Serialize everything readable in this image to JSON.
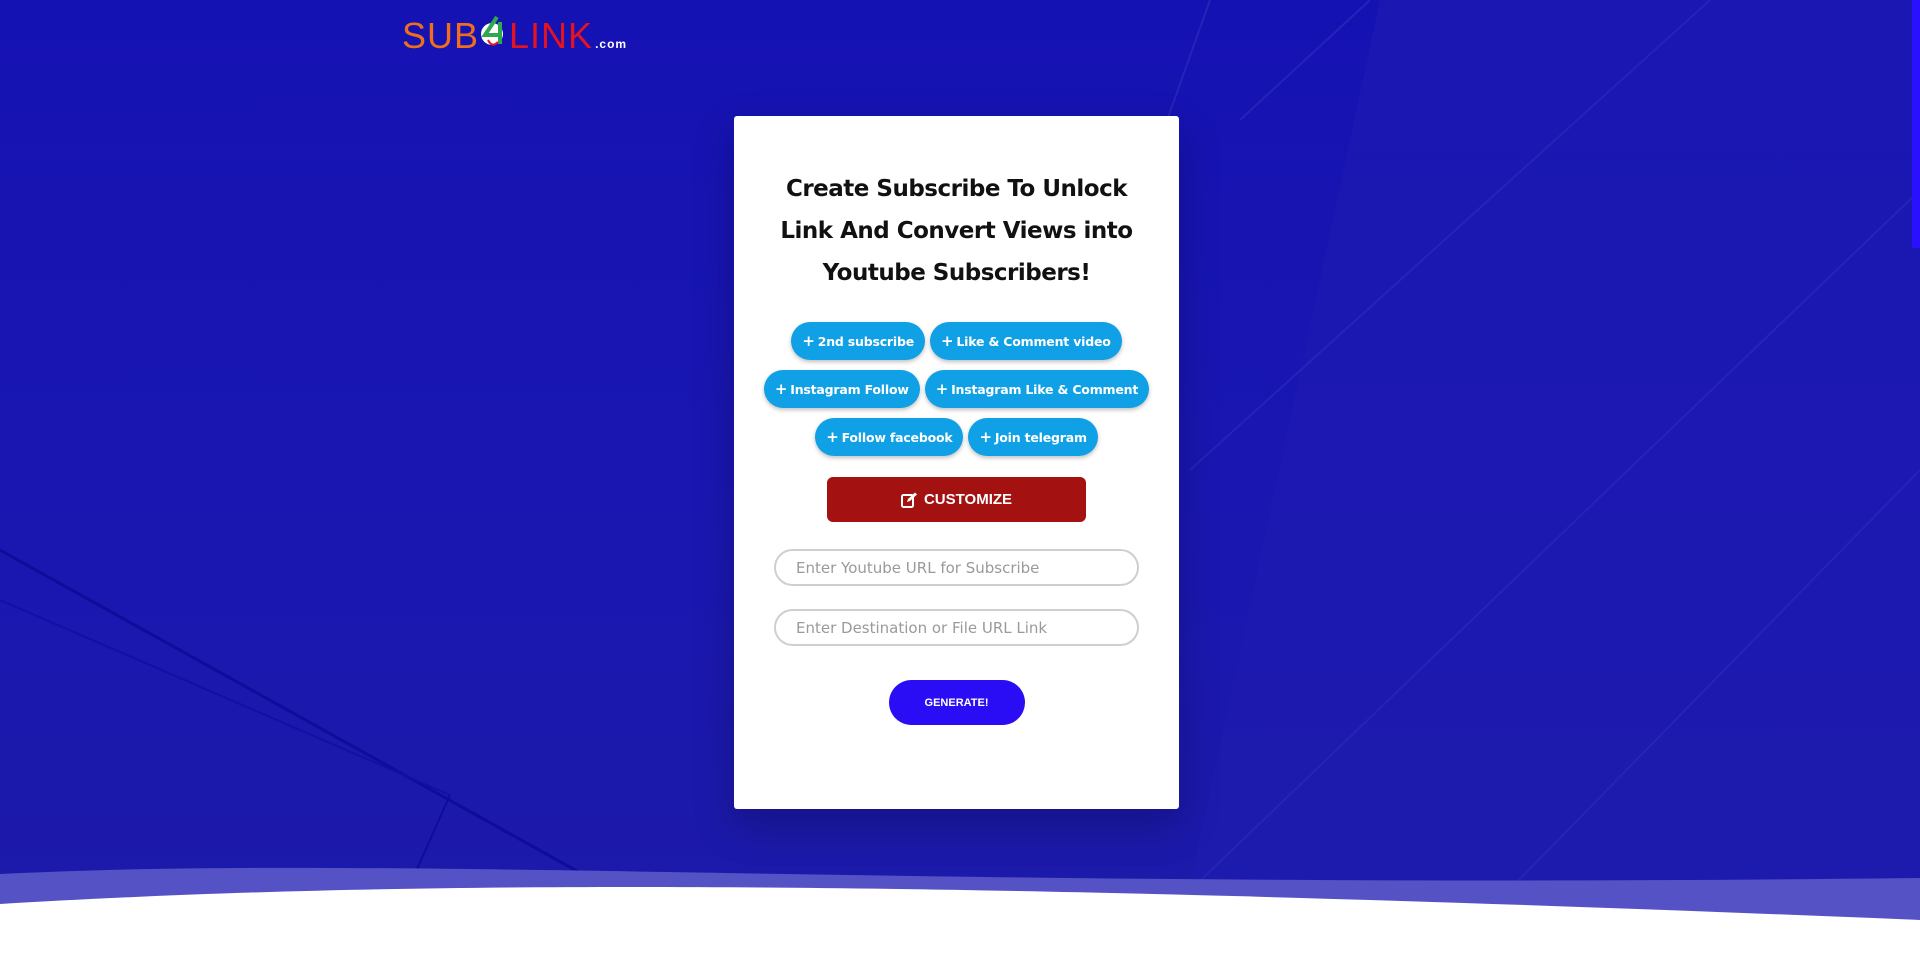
{
  "brand": {
    "logo_sub": "SUB",
    "logo_link": "LINK",
    "logo_domain": ".com",
    "colors": {
      "sub": "#f06e1b",
      "link": "#e5121f",
      "four": "#2fa84f"
    }
  },
  "card": {
    "heading": "Create Subscribe To Unlock Link And Convert Views into Youtube Subscribers!",
    "chips": [
      {
        "icon": "plus-icon",
        "label": "2nd subscribe"
      },
      {
        "icon": "plus-icon",
        "label": "Like & Comment video"
      },
      {
        "icon": "plus-icon",
        "label": "Instagram Follow"
      },
      {
        "icon": "plus-icon",
        "label": "Instagram Like & Comment"
      },
      {
        "icon": "plus-icon",
        "label": "Follow facebook"
      },
      {
        "icon": "plus-icon",
        "label": "Join telegram"
      }
    ],
    "customize_label": "CUSTOMIZE",
    "customize_icon": "edit-icon",
    "youtube_placeholder": "Enter Youtube URL for Subscribe",
    "youtube_value": "",
    "destination_placeholder": "Enter Destination or File URL Link",
    "destination_value": "",
    "generate_label": "GENERATE!"
  },
  "colors": {
    "background": "#1512b3",
    "chip": "#10a0e6",
    "customize": "#a41111",
    "generate": "#2a0cf5"
  }
}
